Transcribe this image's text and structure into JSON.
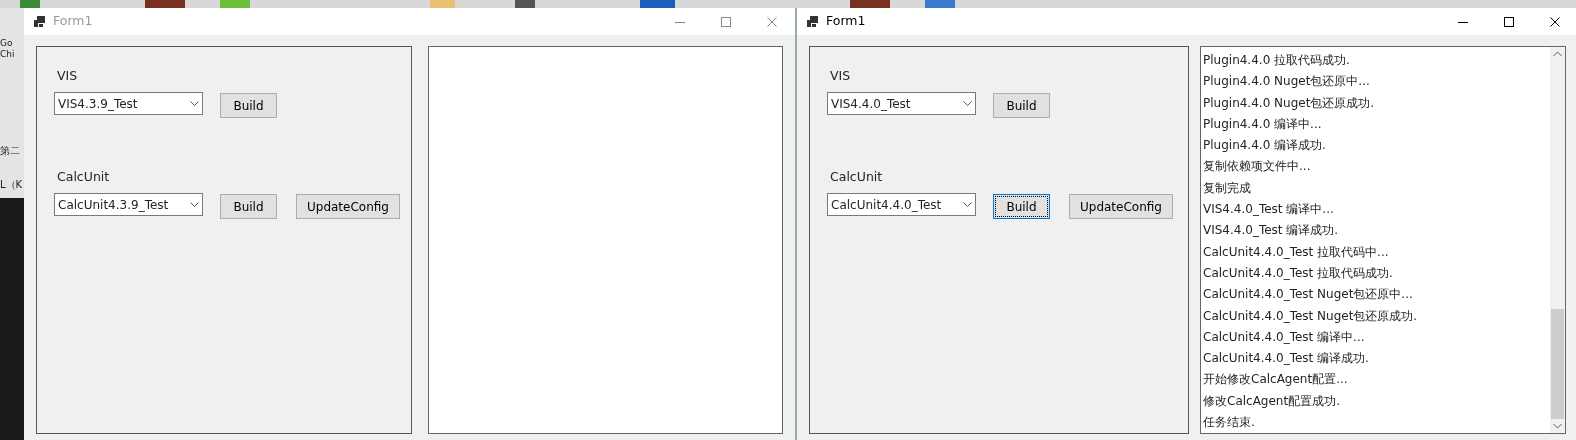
{
  "desktop": {
    "labels": [
      "Go",
      "Chi",
      "第二",
      "L（K"
    ]
  },
  "windows": [
    {
      "title": "Form1",
      "active": false,
      "groups": [
        {
          "label": "VIS",
          "combo": "VIS4.3.9_Test",
          "buttons": [
            {
              "label": "Build",
              "focused": false
            }
          ]
        },
        {
          "label": "CalcUnit",
          "combo": "CalcUnit4.3.9_Test",
          "buttons": [
            {
              "label": "Build",
              "focused": false
            },
            {
              "label": "UpdateConfig",
              "focused": false
            }
          ]
        }
      ]
    },
    {
      "title": "Form1",
      "active": true,
      "groups": [
        {
          "label": "VIS",
          "combo": "VIS4.4.0_Test",
          "buttons": [
            {
              "label": "Build",
              "focused": false
            }
          ]
        },
        {
          "label": "CalcUnit",
          "combo": "CalcUnit4.4.0_Test",
          "buttons": [
            {
              "label": "Build",
              "focused": true
            },
            {
              "label": "UpdateConfig",
              "focused": false
            }
          ]
        }
      ],
      "log": [
        "Plugin4.4.0 拉取代码成功.",
        "Plugin4.4.0 Nuget包还原中...",
        "Plugin4.4.0 Nuget包还原成功.",
        "Plugin4.4.0 编译中...",
        "Plugin4.4.0 编译成功.",
        "复制依赖项文件中...",
        "复制完成",
        "VIS4.4.0_Test 编译中...",
        "VIS4.4.0_Test 编译成功.",
        "CalcUnit4.4.0_Test 拉取代码中...",
        "CalcUnit4.4.0_Test 拉取代码成功.",
        "CalcUnit4.4.0_Test Nuget包还原中...",
        "CalcUnit4.4.0_Test Nuget包还原成功.",
        "CalcUnit4.4.0_Test 编译中...",
        "CalcUnit4.4.0_Test 编译成功.",
        "开始修改CalcAgent配置...",
        "修改CalcAgent配置成功.",
        "任务结束."
      ]
    }
  ]
}
